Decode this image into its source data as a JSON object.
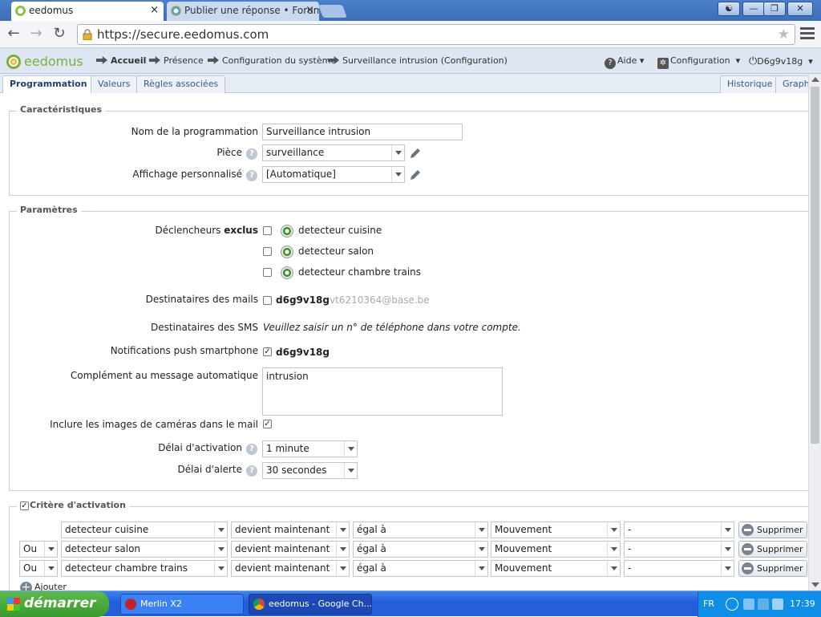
{
  "browser": {
    "tabs": [
      {
        "title": "eedomus",
        "close": "×"
      },
      {
        "title": "Publier une réponse • Forum"
      }
    ],
    "url": "https://secure.eedomus.com"
  },
  "app": {
    "logo": "eedomus",
    "breadcrumb": [
      "Accueil",
      "Présence",
      "Configuration du système",
      "Surveillance intrusion (Configuration)"
    ],
    "help_label": "Aide",
    "config_label": "Configuration",
    "user_label": "D6g9v18g",
    "subtabs": [
      "Programmation",
      "Valeurs",
      "Règles associées"
    ],
    "subtabs_right": [
      "Historique",
      "Graphe"
    ]
  },
  "caracteristiques": {
    "legend": "Caractéristiques",
    "name_label": "Nom de la programmation",
    "name_value": "Surveillance intrusion",
    "piece_label": "Pièce",
    "piece_value": "surveillance",
    "affichage_label": "Affichage personnalisé",
    "affichage_value": "[Automatique]"
  },
  "parametres": {
    "legend": "Paramètres",
    "declencheurs_label": "Déclencheurs",
    "declencheurs_bold": "exclus",
    "declencheurs": [
      {
        "label": "detecteur cuisine",
        "checked": false
      },
      {
        "label": "detecteur salon",
        "checked": false
      },
      {
        "label": "detecteur chambre trains",
        "checked": false
      }
    ],
    "mails_label": "Destinataires des mails",
    "mails_user": "d6g9v18g",
    "mails_email": "vt6210364@base.be",
    "sms_label": "Destinataires des SMS",
    "sms_value": "Veuillez saisir un n° de téléphone dans votre compte.",
    "push_label": "Notifications push smartphone",
    "push_user": "d6g9v18g",
    "complement_label": "Complément au message automatique",
    "complement_value": "intrusion",
    "cameras_label": "Inclure les images de caméras dans le mail",
    "delai_activation_label": "Délai d'activation",
    "delai_activation_value": "1 minute",
    "delai_alerte_label": "Délai d'alerte",
    "delai_alerte_value": "30 secondes"
  },
  "criteres": {
    "legend": "Critère d'activation",
    "rows": [
      {
        "logic": "",
        "device": "detecteur cuisine",
        "change": "devient maintenant",
        "op": "égal à",
        "value": "Mouvement",
        "extra": "-",
        "delete": "Supprimer"
      },
      {
        "logic": "Ou",
        "device": "detecteur salon",
        "change": "devient maintenant",
        "op": "égal à",
        "value": "Mouvement",
        "extra": "-",
        "delete": "Supprimer"
      },
      {
        "logic": "Ou",
        "device": "detecteur chambre trains",
        "change": "devient maintenant",
        "op": "égal à",
        "value": "Mouvement",
        "extra": "-",
        "delete": "Supprimer"
      }
    ],
    "add_label": "Ajouter"
  },
  "taskbar": {
    "start": "démarrer",
    "tasks": [
      "Merlin X2",
      "eedomus - Google Ch..."
    ],
    "lang": "FR",
    "clock": "17:39"
  },
  "colors": {
    "accent": "#7ab03b",
    "link": "#2e5a94",
    "taskbar": "#245edb"
  }
}
